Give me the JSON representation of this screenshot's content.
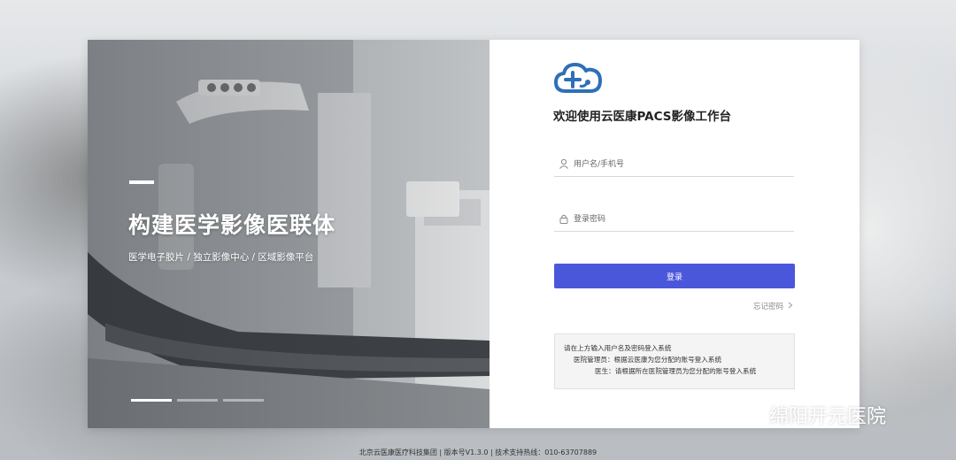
{
  "hero": {
    "title": "构建医学影像医联体",
    "subtitle": "医学电子胶片 /  独立影像中心 /  区域影像平台",
    "slides": 3,
    "active_slide": 1
  },
  "login": {
    "welcome": "欢迎使用云医康PACS影像工作台",
    "username_placeholder": "用户名/手机号",
    "password_placeholder": "登录密码",
    "login_label": "登录",
    "forgot_label": "忘记密码"
  },
  "notice": {
    "line1": "请在上方输入用户名及密码登入系统",
    "line2": "医院管理员：根据云医康为您分配的账号登入系统",
    "line3": "医生：请根据所在医院管理员为您分配的账号登入系统"
  },
  "watermark": "绵阳开元医院",
  "footer": "北京云医康医疗科技集团 | 版本号V1.3.0 | 技术支持热线：010-63707889",
  "colors": {
    "primary": "#4b57db",
    "logo": "#2f6fb8"
  },
  "icons": {
    "logo": "cloud-plus-logo-icon",
    "user": "user-icon",
    "lock": "lock-icon",
    "chevron": "chevron-right-icon",
    "wechat": "wechat-icon"
  }
}
